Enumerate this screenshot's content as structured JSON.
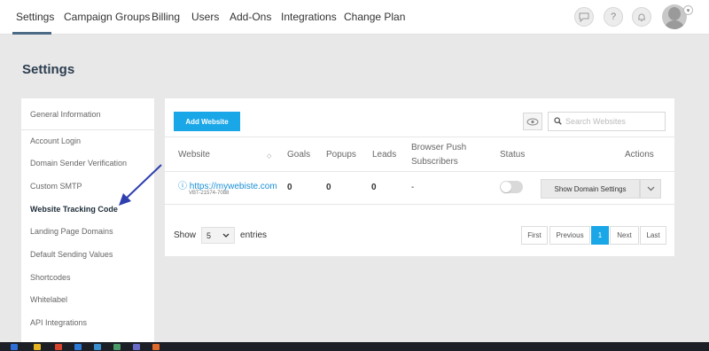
{
  "nav": {
    "tabs": [
      {
        "label": "Settings",
        "active": true
      },
      {
        "label": "Campaign Groups"
      },
      {
        "label": "Billing"
      },
      {
        "label": "Users"
      },
      {
        "label": "Add-Ons"
      },
      {
        "label": "Integrations"
      },
      {
        "label": "Change Plan"
      }
    ],
    "icons": [
      "chat-icon",
      "help-icon",
      "bell-icon",
      "avatar"
    ],
    "help_glyph": "?"
  },
  "page": {
    "title": "Settings"
  },
  "side_menu": {
    "items": [
      {
        "label": "General Information"
      },
      {
        "label": "Account Login"
      },
      {
        "label": "Domain Sender Verification"
      },
      {
        "label": "Custom SMTP"
      },
      {
        "label": "Website Tracking Code",
        "active": true
      },
      {
        "label": "Landing Page Domains"
      },
      {
        "label": "Default Sending Values"
      },
      {
        "label": "Shortcodes"
      },
      {
        "label": "Whitelabel"
      },
      {
        "label": "API Integrations"
      }
    ]
  },
  "main": {
    "add_button": "Add Website",
    "search_placeholder": "Search Websites",
    "columns": [
      "Website",
      "Goals",
      "Popups",
      "Leads",
      "Browser Push",
      "Subscribers",
      "Status",
      "Actions"
    ],
    "rows": [
      {
        "website": "https://mywebiste.com",
        "code": "VBT-21574-7088",
        "goals": "0",
        "popups": "0",
        "leads": "0",
        "subscribers": "-",
        "status": "off",
        "action": "Show Domain Settings"
      }
    ],
    "show_label": "Show",
    "entries_value": "5",
    "entries_label": "entries",
    "pagination": [
      "First",
      "Previous",
      "1",
      "Next",
      "Last"
    ],
    "current_page": "1"
  },
  "colors": {
    "accent": "#1aa7e8",
    "link": "#1a8fd6",
    "nav_underline": "#4c6a85",
    "annotation_arrow": "#2f3fae"
  }
}
